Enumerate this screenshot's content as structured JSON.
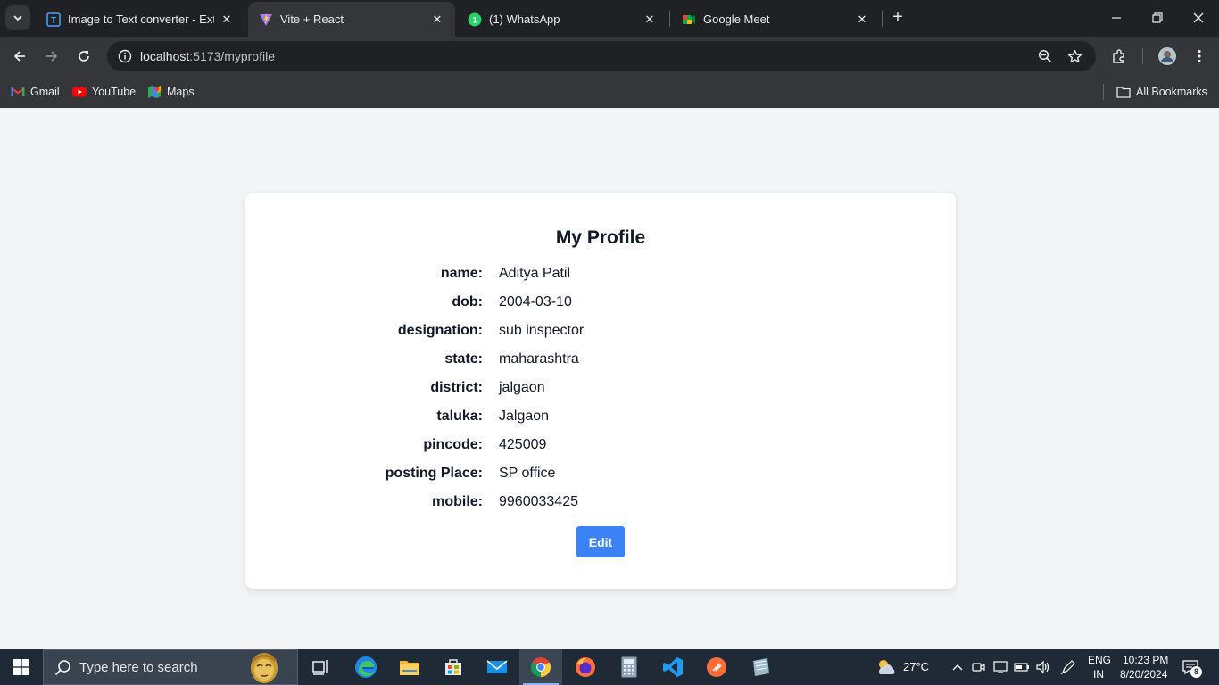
{
  "browser": {
    "tabs": [
      {
        "title": "Image to Text converter - Extract",
        "favicon": "image-to-text-icon",
        "active": false
      },
      {
        "title": "Vite + React",
        "favicon": "vite-icon",
        "active": true
      },
      {
        "title": "(1) WhatsApp",
        "favicon": "whatsapp-icon",
        "active": false
      },
      {
        "title": "Google Meet",
        "favicon": "google-meet-icon",
        "active": false
      }
    ],
    "url_host": "localhost",
    "url_path": ":5173/myprofile",
    "bookmarks": [
      {
        "label": "Gmail",
        "icon": "gmail-icon"
      },
      {
        "label": "YouTube",
        "icon": "youtube-icon"
      },
      {
        "label": "Maps",
        "icon": "maps-icon"
      }
    ],
    "all_bookmarks_label": "All Bookmarks"
  },
  "profile": {
    "title": "My Profile",
    "fields": [
      {
        "label": "name:",
        "value": "Aditya Patil"
      },
      {
        "label": "dob:",
        "value": "2004-03-10"
      },
      {
        "label": "designation:",
        "value": "sub inspector"
      },
      {
        "label": "state:",
        "value": "maharashtra"
      },
      {
        "label": "district:",
        "value": "jalgaon"
      },
      {
        "label": "taluka:",
        "value": "Jalgaon"
      },
      {
        "label": "pincode:",
        "value": "425009"
      },
      {
        "label": "posting Place:",
        "value": "SP office"
      },
      {
        "label": "mobile:",
        "value": "9960033425"
      }
    ],
    "edit_label": "Edit",
    "accent_color": "#3b82f6"
  },
  "taskbar": {
    "search_placeholder": "Type here to search",
    "weather_temp": "27°C",
    "language": "ENG",
    "region": "IN",
    "time": "10:23 PM",
    "date": "8/20/2024",
    "notification_count": "8"
  }
}
